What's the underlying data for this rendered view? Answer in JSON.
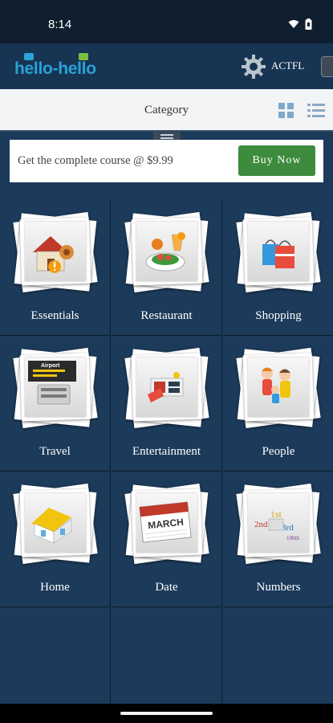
{
  "status_bar": {
    "time": "8:14",
    "icons": [
      "wifi-icon",
      "battery-icon"
    ]
  },
  "header": {
    "logo_part1": "hello",
    "logo_dash": "-",
    "logo_part2": "hello",
    "badge_label": "ACTFL",
    "icons": [
      "actfl-gear-icon",
      "side-drawer-handle"
    ]
  },
  "toolbar": {
    "title": "Category",
    "icons": [
      "grid-view-icon",
      "list-view-icon"
    ]
  },
  "promo": {
    "text": "Get the complete course @ $9.99",
    "button_label": "Buy Now"
  },
  "categories": [
    {
      "label": "Essentials",
      "icon": "essentials-icon"
    },
    {
      "label": "Restaurant",
      "icon": "restaurant-icon"
    },
    {
      "label": "Shopping",
      "icon": "shopping-icon"
    },
    {
      "label": "Travel",
      "icon": "travel-icon",
      "art_text": "Airport"
    },
    {
      "label": "Entertainment",
      "icon": "entertainment-icon"
    },
    {
      "label": "People",
      "icon": "people-icon"
    },
    {
      "label": "Home",
      "icon": "home-icon"
    },
    {
      "label": "Date",
      "icon": "calendar-icon",
      "art_text": "MARCH"
    },
    {
      "label": "Numbers",
      "icon": "numbers-icon",
      "art_text": [
        "2nd",
        "1st",
        "3rd",
        "100th"
      ]
    }
  ],
  "colors": {
    "background": "#1c3a5a",
    "header": "#173453",
    "logo": "#29a2d8",
    "buy_button": "#3d8b3d"
  }
}
